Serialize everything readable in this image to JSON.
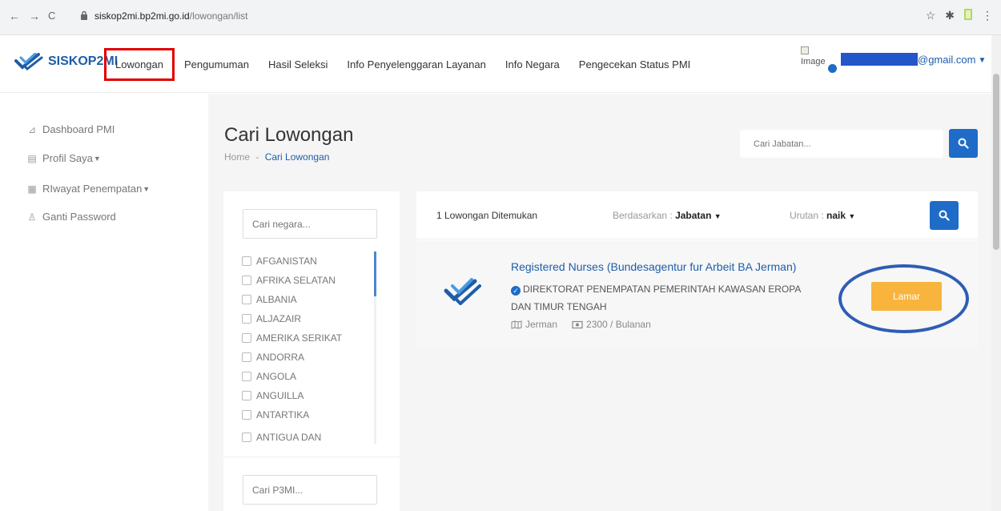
{
  "browser": {
    "back": "←",
    "forward": "→",
    "reload": "C",
    "url_host": "siskop2mi.bp2mi.go.id",
    "url_path": "/lowongan/list",
    "icons": [
      "star-icon",
      "extension-icon",
      "bookmark-icon",
      "menu-icon"
    ]
  },
  "header": {
    "logo_text": "SISKOP2MI",
    "nav": [
      "Lowongan",
      "Pengumuman",
      "Hasil Seleksi",
      "Info Penyelenggaran Layanan",
      "Info Negara",
      "Pengecekan Status PMI"
    ],
    "avatar_alt": "Image",
    "email_suffix": "@gmail.com"
  },
  "sidebar": {
    "items": [
      {
        "label": "Dashboard PMI",
        "icon": "dashboard-icon"
      },
      {
        "label": "Profil Saya",
        "icon": "profile-icon"
      },
      {
        "label": "RIwayat Penempatan",
        "icon": "history-icon"
      },
      {
        "label": "Ganti Password",
        "icon": "password-icon"
      }
    ]
  },
  "page": {
    "title": "Cari Lowongan",
    "breadcrumb_home": "Home",
    "breadcrumb_sep": "-",
    "breadcrumb_current": "Cari Lowongan",
    "search_placeholder": "Cari Jabatan..."
  },
  "filter": {
    "country_placeholder": "Cari negara...",
    "countries": [
      "AFGANISTAN",
      "AFRIKA SELATAN",
      "ALBANIA",
      "ALJAZAIR",
      "AMERIKA SERIKAT",
      "ANDORRA",
      "ANGOLA",
      "ANGUILLA",
      "ANTARTIKA",
      "ANTIGUA DAN BARBUDA"
    ],
    "p3mi_placeholder": "Cari P3MI..."
  },
  "results": {
    "count_text": "1 Lowongan Ditemukan",
    "sort_by_label": "Berdasarkan :",
    "sort_by_value": "Jabatan",
    "order_label": "Urutan :",
    "order_value": "naik"
  },
  "job": {
    "title": "Registered Nurses (Bundesagentur fur Arbeit BA Jerman)",
    "agency": "DIREKTORAT PENEMPATAN PEMERINTAH KAWASAN EROPA DAN TIMUR TENGAH",
    "country": "Jerman",
    "salary": "2300 / Bulanan",
    "apply_label": "Lamar"
  },
  "colors": {
    "brand": "#1e5da8",
    "primary_button": "#1e6cc7",
    "apply_button": "#f8b43c",
    "highlight_box": "#e00000",
    "annotation_ellipse": "#2e5db4"
  }
}
